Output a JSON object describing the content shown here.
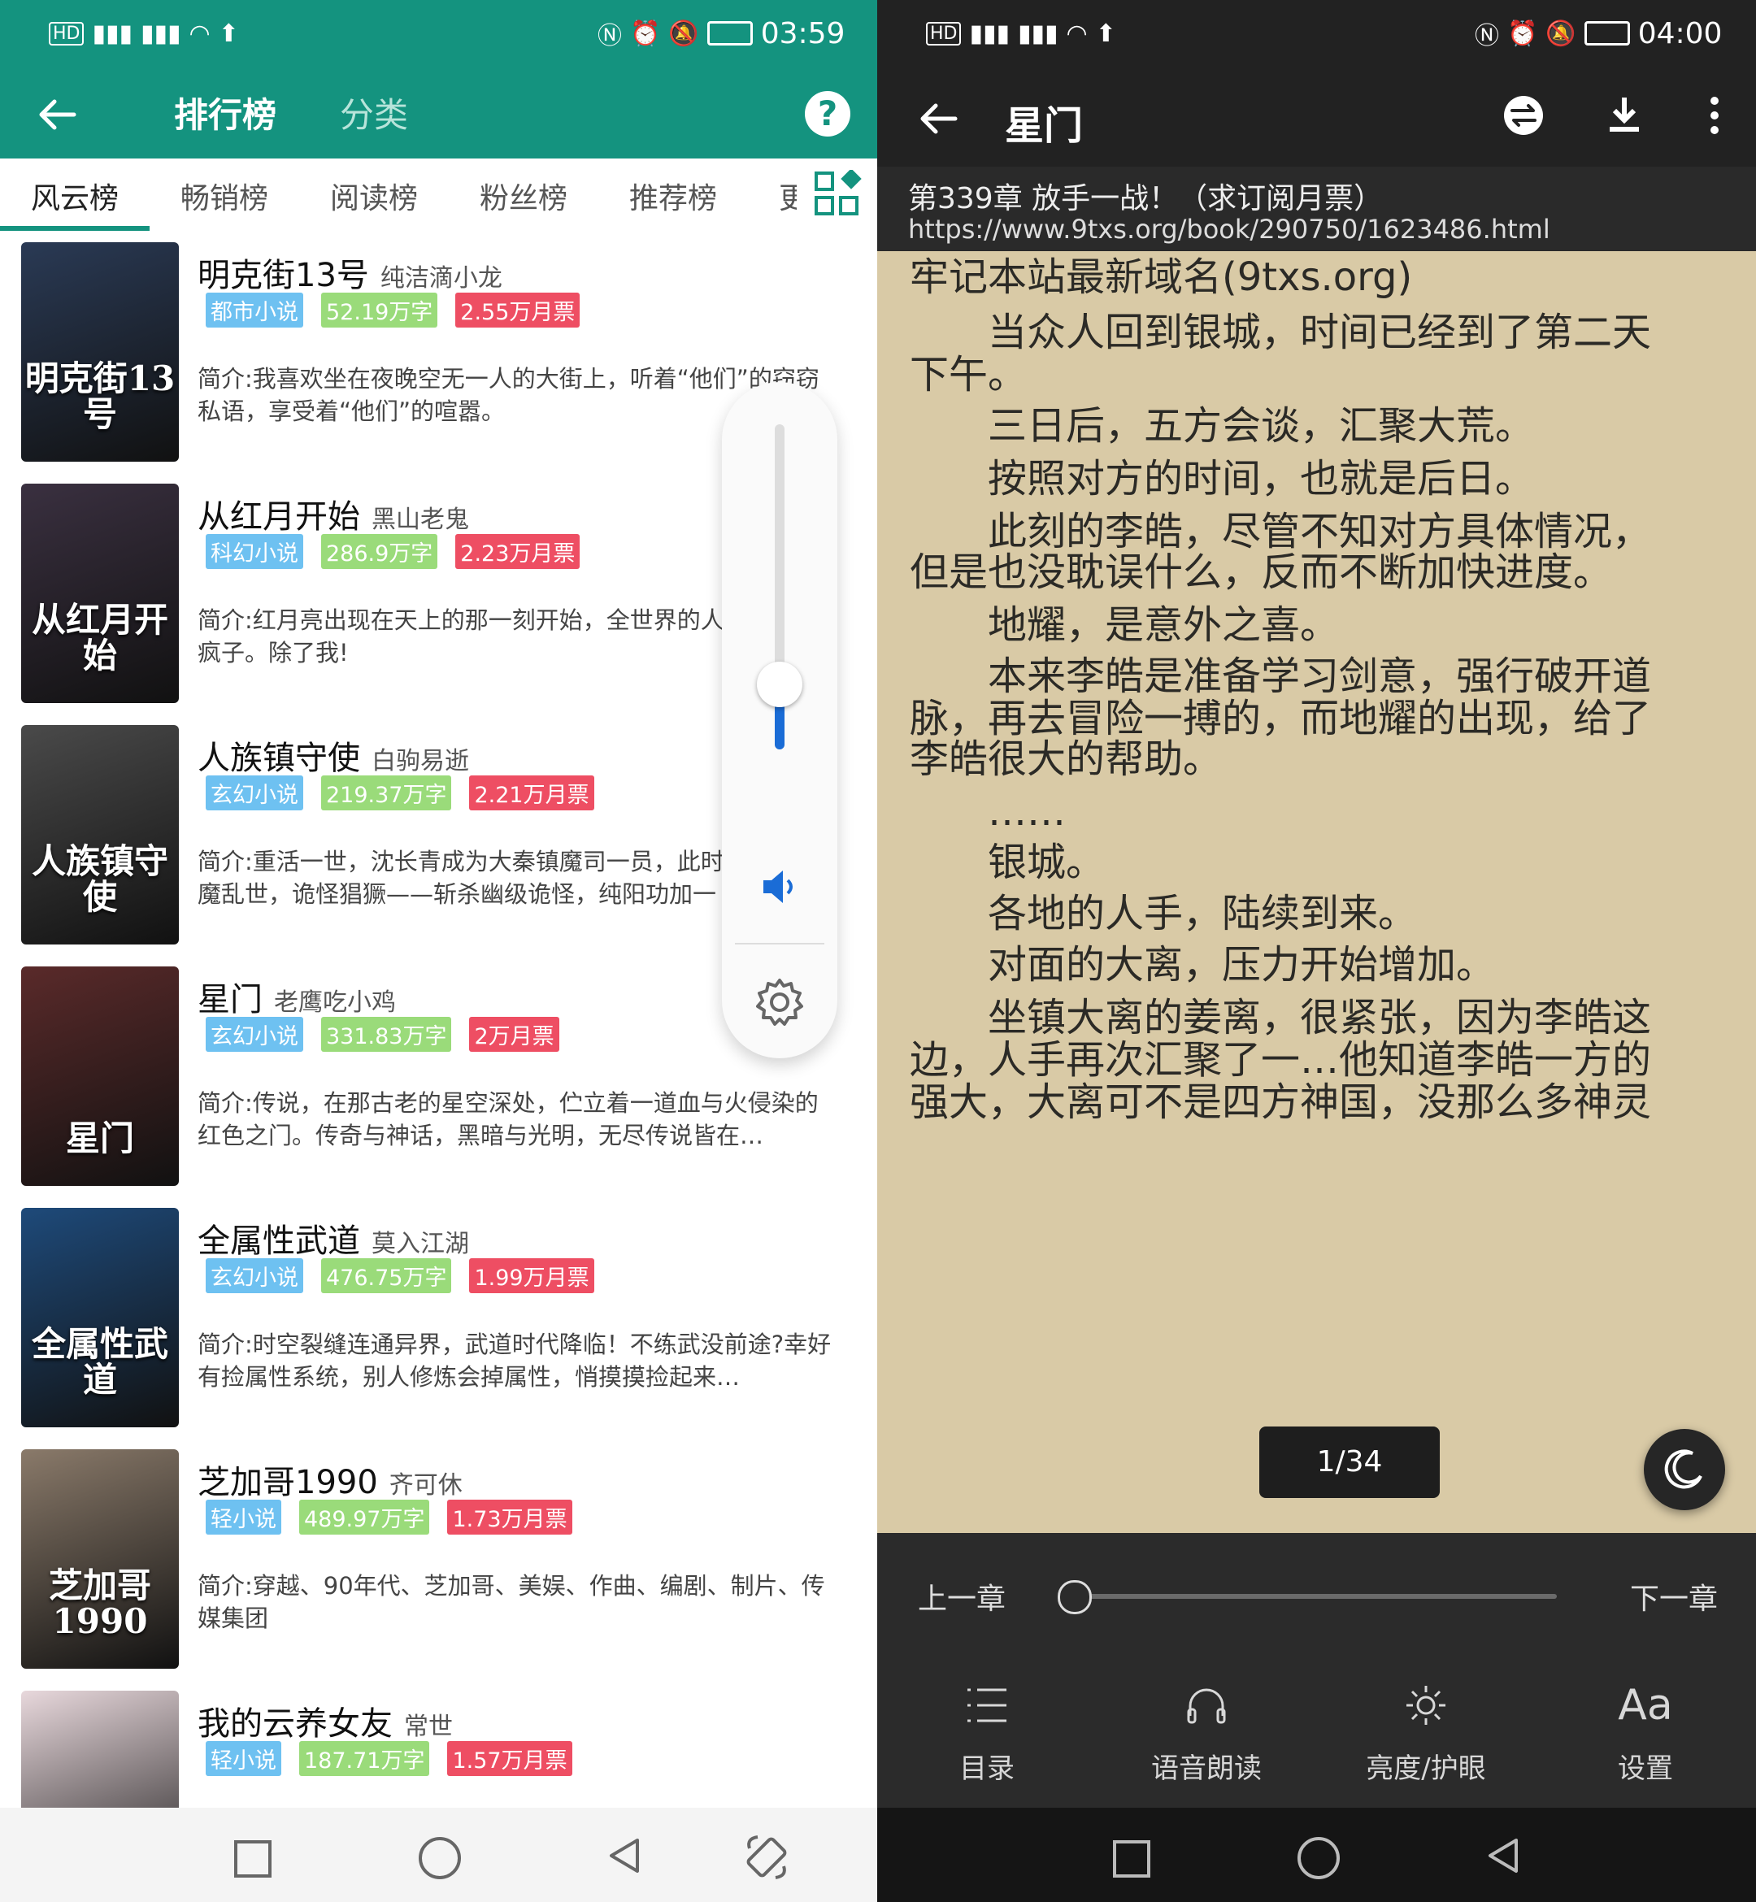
{
  "left": {
    "status": {
      "left_icons": "HD 4G 4G",
      "time": "03:59"
    },
    "header": {
      "tab_active": "排行榜",
      "tab_other": "分类"
    },
    "tabs": [
      "风云榜",
      "畅销榜",
      "阅读榜",
      "粉丝榜",
      "推荐榜",
      "更"
    ],
    "books": [
      {
        "title": "明克街13号",
        "author": "纯洁滴小龙",
        "category": "都市小说",
        "words": "52.19万字",
        "votes": "2.55万月票",
        "intro": "简介:我喜欢坐在夜晚空无一人的大街上，听着“他们”的窃窃私语，享受着“他们”的喧嚣。",
        "cover_text": "明克街13号",
        "cover_color": "#2a3a55"
      },
      {
        "title": "从红月开始",
        "author": "黑山老鬼",
        "category": "科幻小说",
        "words": "286.9万字",
        "votes": "2.23万月票",
        "intro": "简介:红月亮出现在天上的那一刻开始，全世界的人都疯了，疯子。除了我!",
        "cover_text": "从红月开始",
        "cover_color": "#3a3040"
      },
      {
        "title": "人族镇守使",
        "author": "白驹易逝",
        "category": "玄幻小说",
        "words": "219.37万字",
        "votes": "2.21万月票",
        "intro": "简介:重活一世，沈长青成为大秦镇魔司一员，此时的大秦妖魔乱世，诡怪猖獗——斩杀幽级诡怪，纯阳功加一",
        "cover_text": "人族镇守使",
        "cover_color": "#4a4a4a"
      },
      {
        "title": "星门",
        "author": "老鹰吃小鸡",
        "category": "玄幻小说",
        "words": "331.83万字",
        "votes": "2万月票",
        "intro": "简介:传说，在那古老的星空深处，伫立着一道血与火侵染的红色之门。传奇与神话，黑暗与光明，无尽传说皆在…",
        "cover_text": "星门",
        "cover_color": "#5a2a2a"
      },
      {
        "title": "全属性武道",
        "author": "莫入江湖",
        "category": "玄幻小说",
        "words": "476.75万字",
        "votes": "1.99万月票",
        "intro": "简介:时空裂缝连通异界，武道时代降临！不练武没前途?幸好有捡属性系统，别人修炼会掉属性，悄摸摸捡起来…",
        "cover_text": "全属性武道",
        "cover_color": "#1e4a7a"
      },
      {
        "title": "芝加哥1990",
        "author": "齐可休",
        "category": "轻小说",
        "words": "489.97万字",
        "votes": "1.73万月票",
        "intro": "简介:穿越、90年代、芝加哥、美娱、作曲、编剧、制片、传媒集团",
        "cover_text": "芝加哥1990",
        "cover_color": "#8a7a6a"
      },
      {
        "title": "我的云养女友",
        "author": "常世",
        "category": "轻小说",
        "words": "187.71万字",
        "votes": "1.57万月票",
        "intro": "",
        "cover_text": "",
        "cover_color": "#e8d8dc"
      }
    ],
    "volume": {
      "level": 0.2
    }
  },
  "right": {
    "status": {
      "time": "04:00"
    },
    "header": {
      "title": "星门"
    },
    "chapter": {
      "title": "第339章 放手一战！（求订阅月票）",
      "url": "https://www.9txs.org/book/290750/1623486.html"
    },
    "lines": [
      "牢记本站最新域名(9txs.org)",
      "　　当众人回到银城，时间已经到了第二天",
      "下午。",
      "　　三日后，五方会谈，汇聚大荒。",
      "　　按照对方的时间，也就是后日。",
      "　　此刻的李皓，尽管不知对方具体情况，",
      "但是也没耽误什么，反而不断加快进度。",
      "　　地耀，是意外之喜。",
      "　　本来李皓是准备学习剑意，强行破开道",
      "脉，再去冒险一搏的，而地耀的出现，给了",
      "李皓很大的帮助。",
      "　　……",
      "　　银城。",
      "　　各地的人手，陆续到来。",
      "　　对面的大离，压力开始增加。",
      "　　坐镇大离的姜离，很紧张，因为李皓这",
      "边，人手再次汇聚了一…他知道李皓一方的",
      "强大，大离可不是四方神国，没那么多神灵"
    ],
    "page_indicator": "1/34",
    "prev_chapter": "上一章",
    "next_chapter": "下一章",
    "progress": 0.0,
    "menu": [
      "目录",
      "语音朗读",
      "亮度/护眼",
      "设置"
    ]
  }
}
